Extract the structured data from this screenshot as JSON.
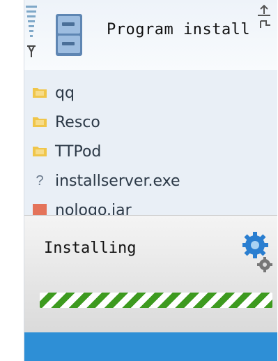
{
  "header": {
    "title": "Program install",
    "signal_icon": "signal-bars-icon",
    "app_icon": "cabinet-icon",
    "status_icon": "usb-icon"
  },
  "files": [
    {
      "name": "qq",
      "icon": "folder-icon"
    },
    {
      "name": "Resco",
      "icon": "folder-icon"
    },
    {
      "name": "TTPod",
      "icon": "folder-icon"
    },
    {
      "name": "installserver.exe",
      "icon": "unknown-file-icon"
    },
    {
      "name": "nologo.jar",
      "icon": "jar-file-icon"
    }
  ],
  "dialog": {
    "title": "Installing",
    "icon": "gears-icon",
    "progress_fraction": 1.0
  },
  "colors": {
    "accent": "#2e8fd6",
    "progress": "#3d9a1f",
    "folder": "#f0c64a"
  }
}
